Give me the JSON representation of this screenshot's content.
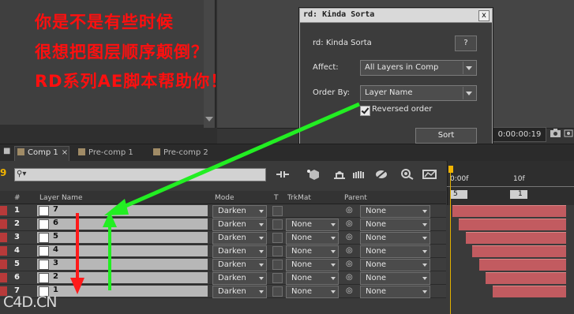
{
  "overlay_text": {
    "line1": "你是不是有些时候",
    "line2": "很想把图层顺序颠倒？",
    "line3": "RD系列AE脚本帮助你！"
  },
  "viewer": {
    "timecode": "0:00:00:19"
  },
  "dialog": {
    "title": "rd: Kinda Sorta",
    "close_label": "x",
    "name_label": "rd: Kinda Sorta",
    "help_label": "?",
    "affect_label": "Affect:",
    "affect_value": "All Layers in Comp",
    "order_label": "Order By:",
    "order_value": "Layer Name",
    "reversed_label": "Reversed order",
    "reversed_checked": true,
    "sort_label": "Sort"
  },
  "tabs": {
    "left_indicator": "■",
    "items": [
      {
        "label": "Comp 1",
        "close": "×"
      },
      {
        "label": "Pre-comp 1"
      },
      {
        "label": "Pre-comp 2"
      }
    ]
  },
  "toolbar": {
    "search_icon": "⚲▾"
  },
  "ruler": {
    "start": "0:00f",
    "mark": "10f",
    "marker_a": "5",
    "marker_b": "1"
  },
  "headers": {
    "num": "#",
    "name": "Layer Name",
    "mode": "Mode",
    "t": "T",
    "trkmat": "TrkMat",
    "parent": "Parent"
  },
  "layers": [
    {
      "num": "1",
      "name": "7",
      "mode": "Darken",
      "trkmat": "",
      "parent": "None"
    },
    {
      "num": "2",
      "name": "6",
      "mode": "Darken",
      "trkmat": "None",
      "parent": "None"
    },
    {
      "num": "3",
      "name": "5",
      "mode": "Darken",
      "trkmat": "None",
      "parent": "None"
    },
    {
      "num": "4",
      "name": "4",
      "mode": "Darken",
      "trkmat": "None",
      "parent": "None"
    },
    {
      "num": "5",
      "name": "3",
      "mode": "Darken",
      "trkmat": "None",
      "parent": "None"
    },
    {
      "num": "6",
      "name": "2",
      "mode": "Darken",
      "trkmat": "None",
      "parent": "None"
    },
    {
      "num": "7",
      "name": "1",
      "mode": "Darken",
      "trkmat": "None",
      "parent": "None"
    }
  ],
  "watermark": "C4D.CN",
  "colors": {
    "overlay_red": "#ff0f0f",
    "arrow_green": "#22ee22",
    "arrow_red": "#ff1a1a",
    "layer_label": "#b83a3a",
    "layer_bar": "#c25b60",
    "cti": "#f2b400"
  }
}
